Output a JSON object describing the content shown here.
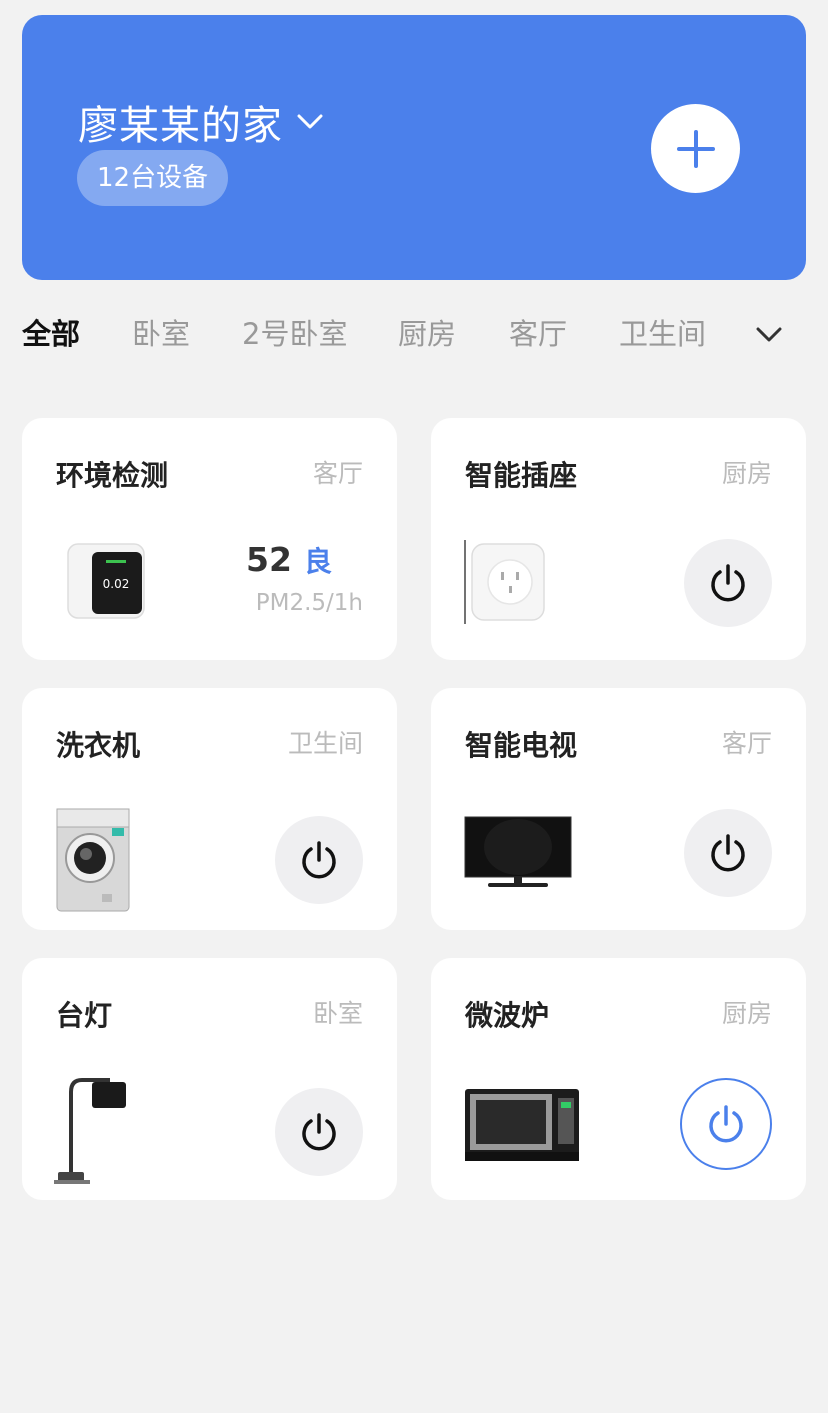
{
  "header": {
    "home_name": "廖某某的家",
    "device_count": "12台设备",
    "chevron_icon": "chevron-down-icon",
    "add_icon": "plus-icon",
    "color": "#4b80eb"
  },
  "tabs": {
    "items": [
      {
        "label": "全部",
        "active": true
      },
      {
        "label": "卧室",
        "active": false
      },
      {
        "label": "2号卧室",
        "active": false
      },
      {
        "label": "厨房",
        "active": false
      },
      {
        "label": "客厅",
        "active": false
      },
      {
        "label": "卫生间",
        "active": false
      }
    ],
    "more_icon": "chevron-down-icon"
  },
  "devices": [
    {
      "name": "环境检测",
      "room": "客厅",
      "value": "52",
      "level": "良",
      "unit": "PM2.5/1h",
      "icon": "air-monitor-icon"
    },
    {
      "name": "智能插座",
      "room": "厨房",
      "power": "off",
      "icon": "smart-plug-icon"
    },
    {
      "name": "洗衣机",
      "room": "卫生间",
      "power": "off",
      "icon": "washing-machine-icon"
    },
    {
      "name": "智能电视",
      "room": "客厅",
      "power": "off",
      "icon": "tv-icon"
    },
    {
      "name": "台灯",
      "room": "卧室",
      "power": "off",
      "icon": "desk-lamp-icon"
    },
    {
      "name": "微波炉",
      "room": "厨房",
      "power": "on",
      "icon": "microwave-icon"
    }
  ]
}
